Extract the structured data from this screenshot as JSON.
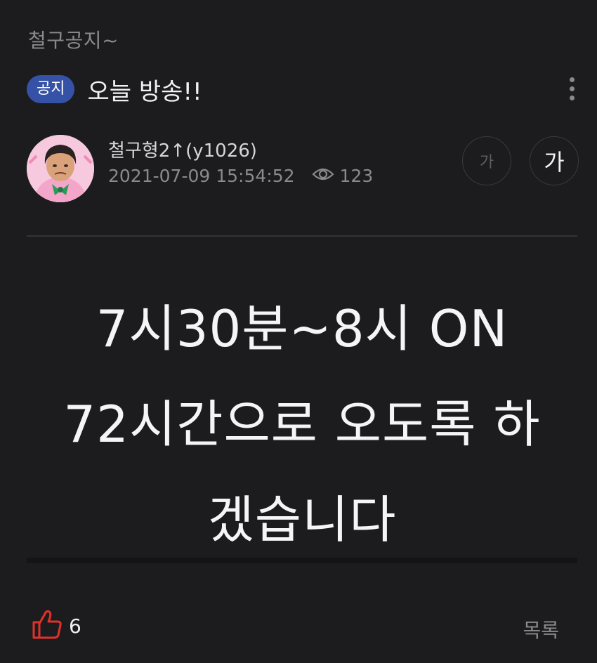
{
  "board": {
    "name": "철구공지~"
  },
  "post": {
    "badge": "공지",
    "title": "오늘 방송!!",
    "author": "철구형2↑(y1026)",
    "datetime": "2021-07-09 15:54:52",
    "views": "123",
    "body_lines": [
      "7시30분~8시 ON",
      "72시간으로 오도록 하",
      "겠습니다"
    ]
  },
  "font_size_buttons": {
    "small": "가",
    "large": "가"
  },
  "footer": {
    "like_count": "6",
    "list_label": "목록"
  },
  "colors": {
    "background": "#1c1c1e",
    "badge": "#3552a6",
    "like_icon": "#e0322b",
    "muted_text": "#8a8a8e"
  },
  "icons": {
    "more": "vertical-dots-icon",
    "views": "eye-icon",
    "like": "thumbs-up-icon"
  }
}
